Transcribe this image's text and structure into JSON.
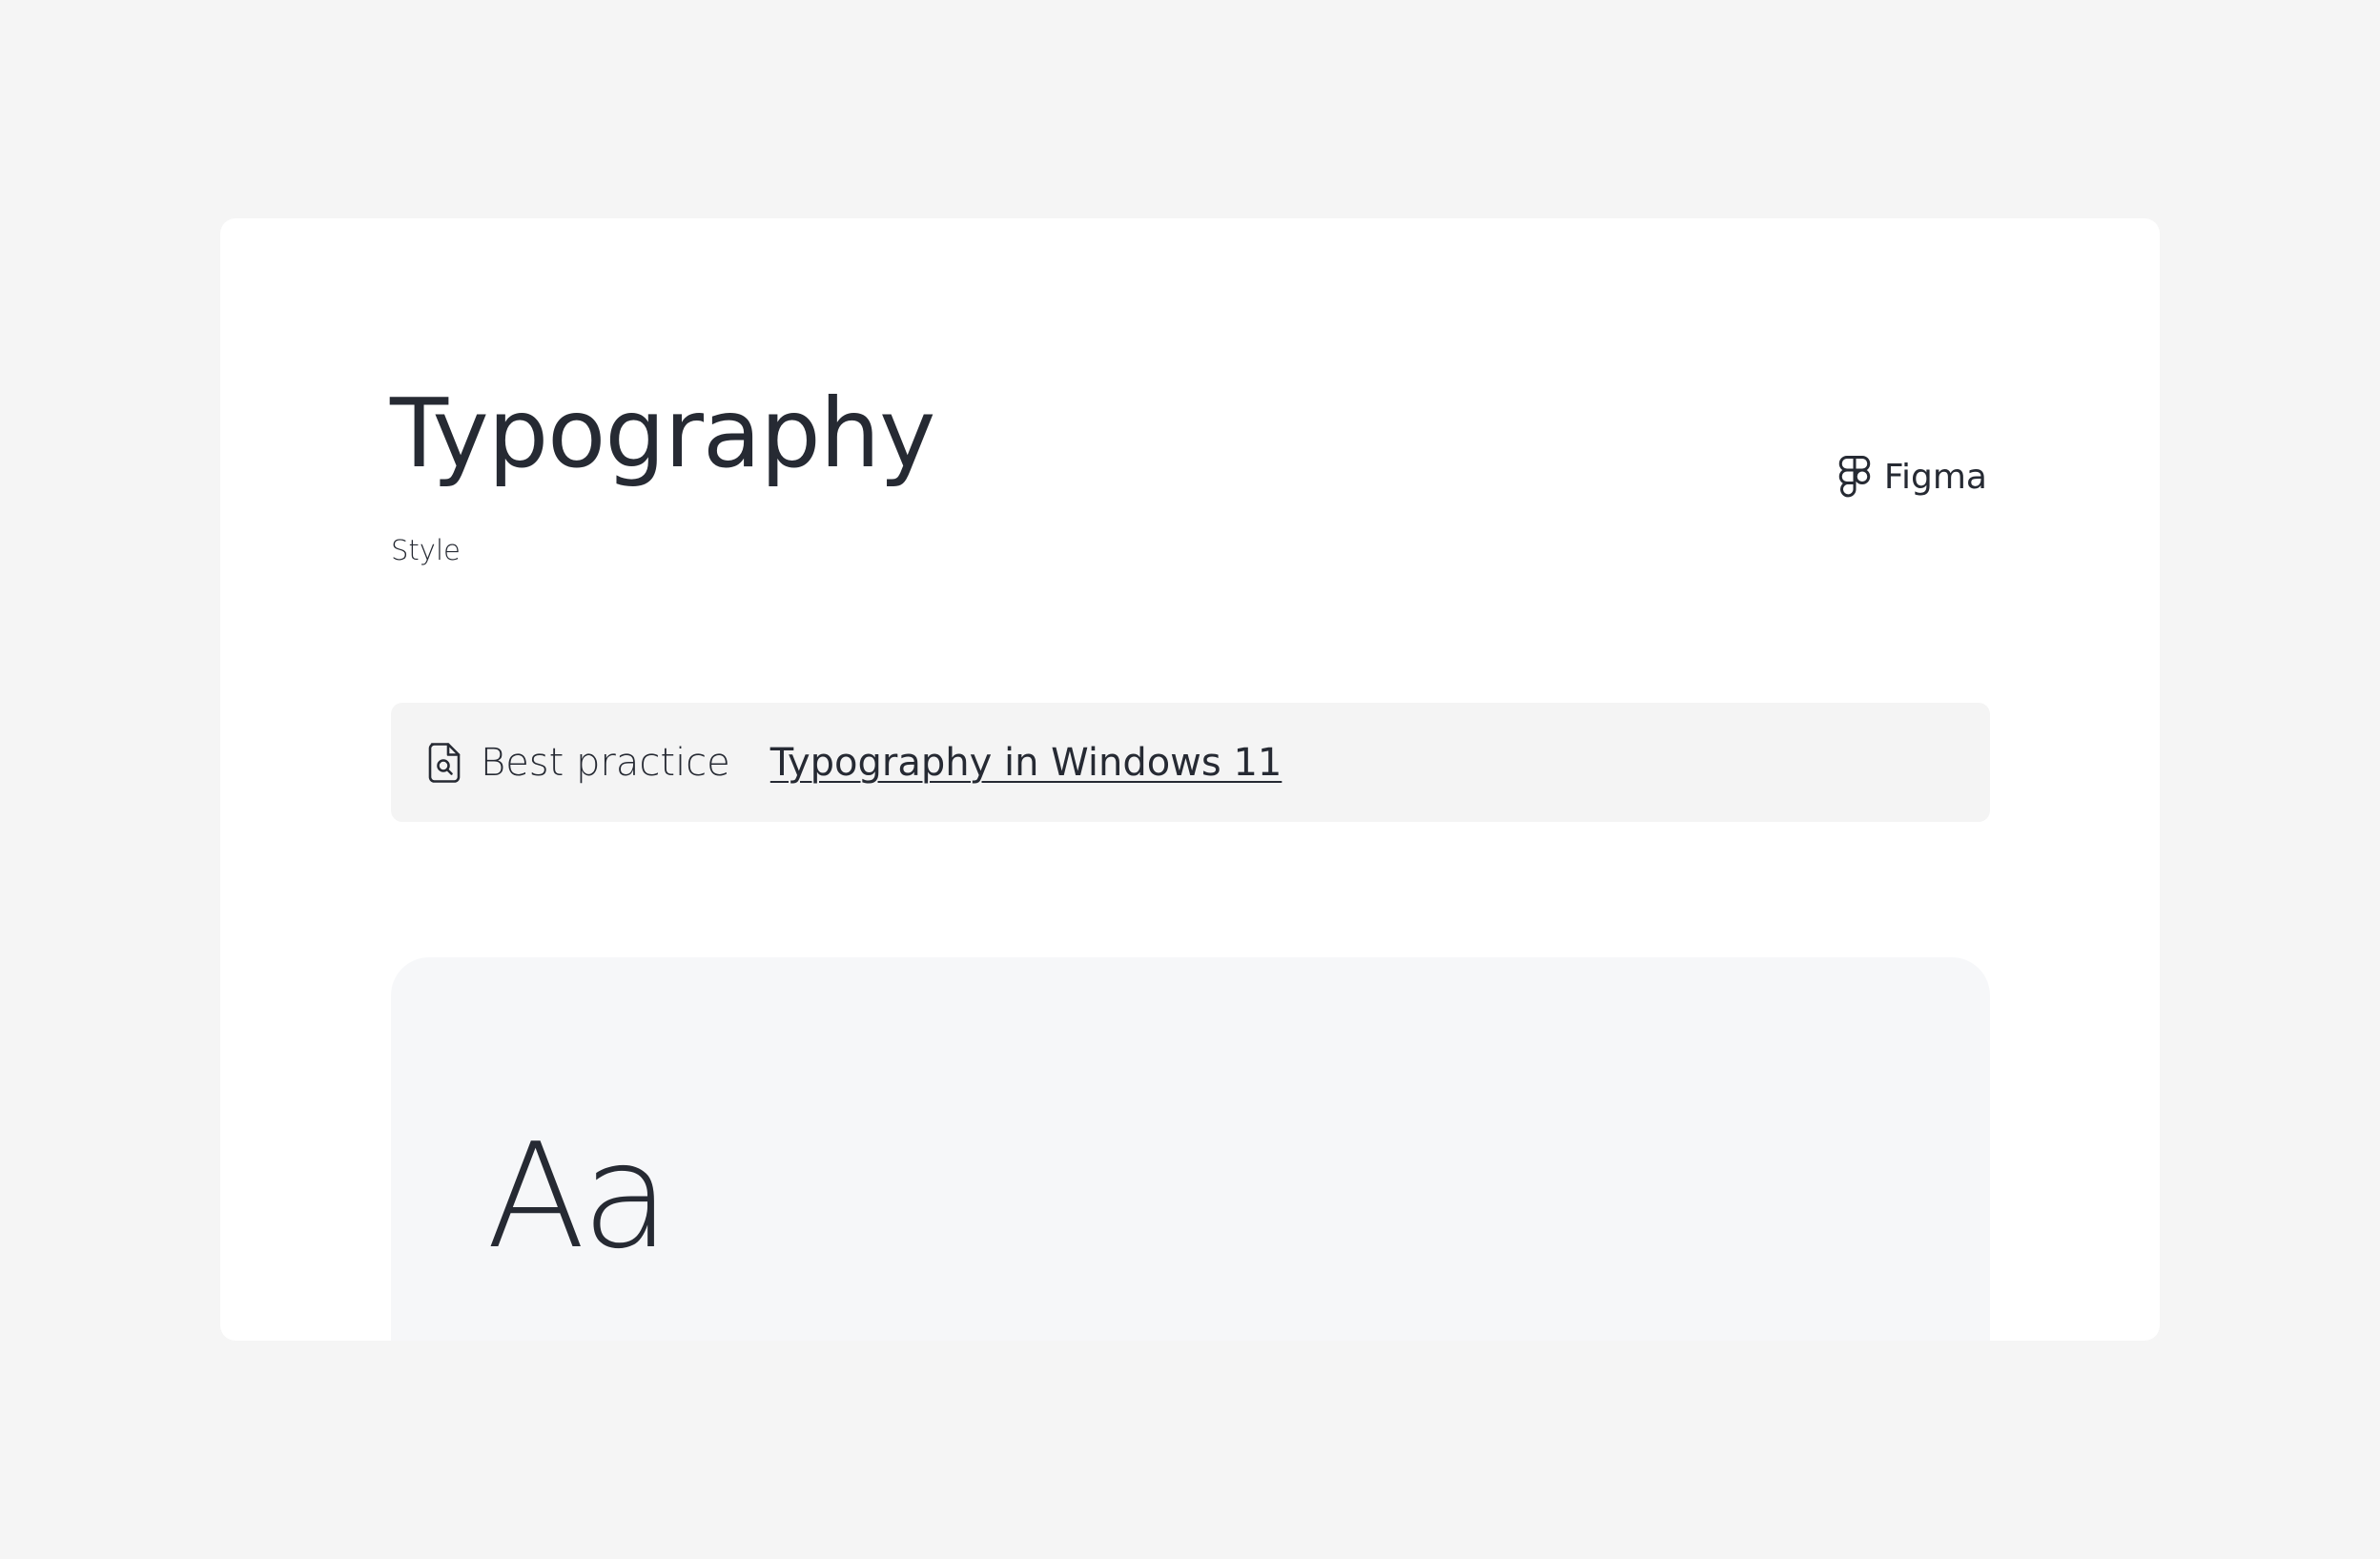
{
  "header": {
    "title": "Typography",
    "subtitle": "Style",
    "figma_link": {
      "label": "Figma",
      "icon": "figma-icon"
    }
  },
  "notice": {
    "icon": "document-search-icon",
    "label": "Best practice",
    "link_text": "Typography in Windows 11"
  },
  "specimen": {
    "sample_text": "Aa"
  },
  "colors": {
    "page_background": "#f5f5f5",
    "card_background": "#ffffff",
    "text": "#262a33",
    "notice_background": "#f4f4f4",
    "specimen_background": "#f6f7f9"
  }
}
